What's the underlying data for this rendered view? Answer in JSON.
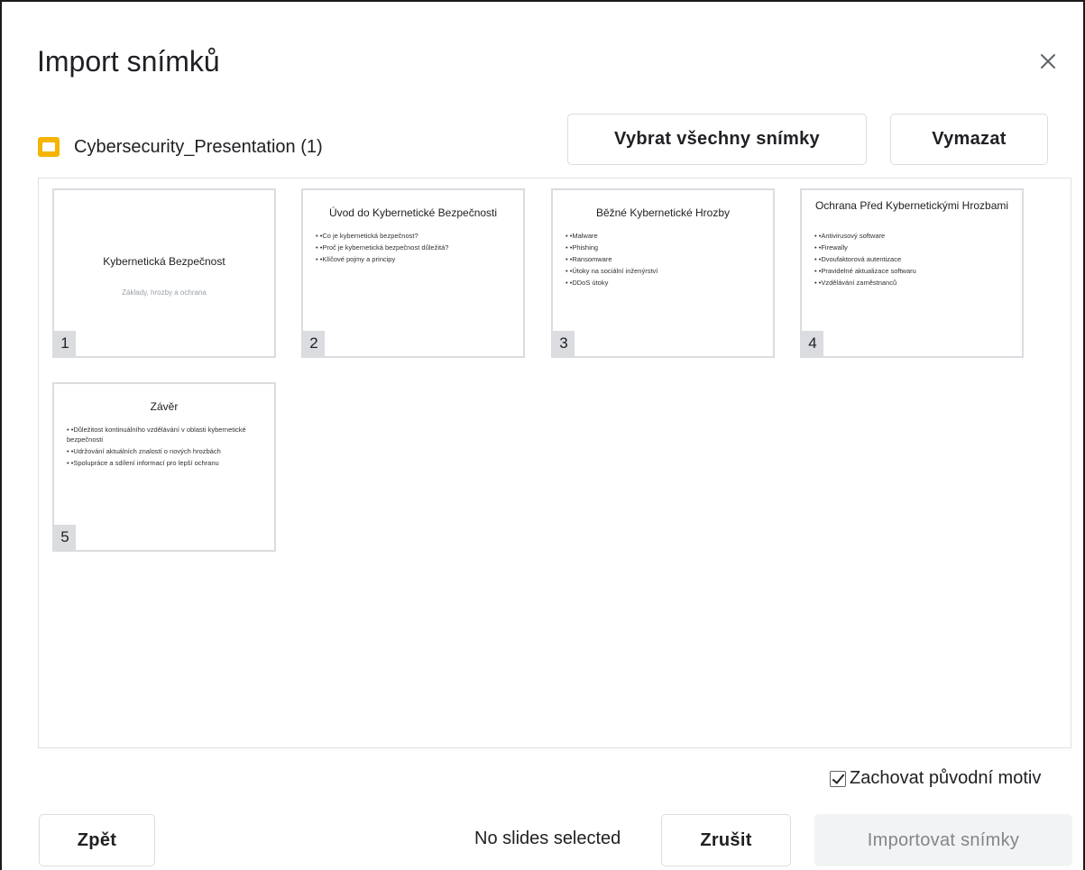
{
  "dialog": {
    "title": "Import snímků",
    "close_icon": "close-icon"
  },
  "source": {
    "file_name": "Cybersecurity_Presentation (1)",
    "icon": "slides-file-icon",
    "icon_color": "#f4b400"
  },
  "toolbar": {
    "select_all_label": "Vybrat všechny snímky",
    "clear_label": "Vymazat"
  },
  "slides": [
    {
      "number": "1",
      "title": "Kybernetická Bezpečnost",
      "subtitle": "Základy, hrozby a ochrana",
      "bullets": []
    },
    {
      "number": "2",
      "title": "Úvod do Kybernetické Bezpečnosti",
      "subtitle": "",
      "bullets": [
        "• •Co je kybernetická bezpečnost?",
        "• •Proč je kybernetická bezpečnost důležitá?",
        "• •Klíčové pojmy a principy"
      ]
    },
    {
      "number": "3",
      "title": "Běžné Kybernetické Hrozby",
      "subtitle": "",
      "bullets": [
        "• •Malware",
        "• •Phishing",
        "• •Ransomware",
        "• •Útoky na sociální inženýrství",
        "• •DDoS útoky"
      ]
    },
    {
      "number": "4",
      "title": "Ochrana Před Kybernetickými Hrozbami",
      "subtitle": "",
      "bullets": [
        "• •Antivirusový software",
        "• •Firewally",
        "• •Dvoufaktorová autentizace",
        "• •Pravidelné aktualizace softwaru",
        "• •Vzdělávání zaměstnanců"
      ]
    },
    {
      "number": "5",
      "title": "Závěr",
      "subtitle": "",
      "bullets": [
        "• •Důležitost kontinuálního vzdělávání v oblasti kybernetické bezpečnosti",
        "• •Udržování aktuálních znalostí o nových hrozbách",
        "• •Spolupráce a sdílení informací pro lepší ochranu"
      ]
    }
  ],
  "options": {
    "keep_theme_label": "Zachovat původní motiv",
    "keep_theme_checked": true
  },
  "footer": {
    "back_label": "Zpět",
    "status_text": "No slides selected",
    "cancel_label": "Zrušit",
    "import_label": "Importovat snímky",
    "import_enabled": false
  }
}
